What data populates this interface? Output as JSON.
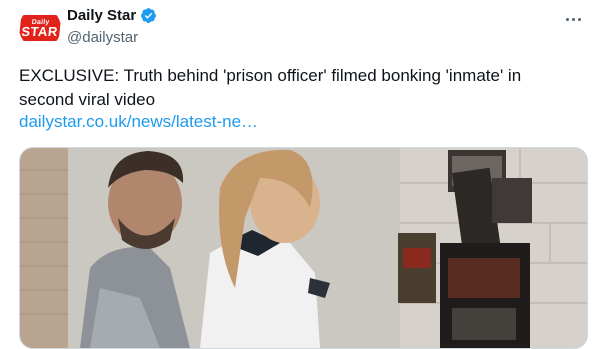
{
  "tweet": {
    "display_name": "Daily Star",
    "handle": "@dailystar",
    "text": "EXCLUSIVE: Truth behind 'prison officer' filmed bonking 'inmate' in second viral video",
    "link": "dailystar.co.uk/news/latest-ne…",
    "logo_line1": "Daily",
    "logo_line2": "STAR"
  },
  "icons": {
    "verified": "verified-badge-icon",
    "more": "more-options-icon"
  },
  "colors": {
    "link": "#1d9bf0",
    "verified": "#1d9bf0",
    "brand": "#e2231a",
    "secondary_text": "#536471"
  }
}
